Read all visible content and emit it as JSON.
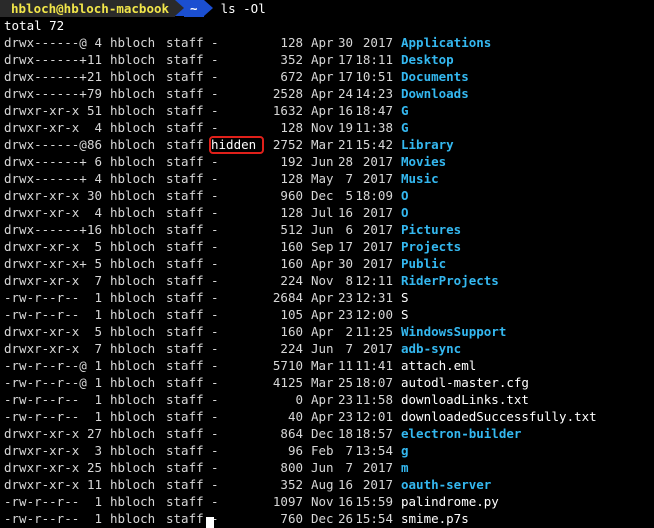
{
  "prompt": {
    "user_host": "hbloch@hbloch-macbook",
    "directory_icon": "home-tilde-icon",
    "directory": "~",
    "command": "ls -Ol"
  },
  "total_line": "total 72",
  "annotation": {
    "label": "hidden",
    "color": "#e0201a"
  },
  "colors": {
    "directory": "#34b8f0",
    "file": "#ffffff",
    "prompt_user": "#f2e64a",
    "prompt_dir_bg": "#1b4fd1"
  },
  "entries": [
    {
      "perm": "drwx------@",
      "links": "4",
      "user": "hbloch",
      "group": "staff",
      "flags": "-",
      "size": "128",
      "month": "Apr",
      "day": "30",
      "time": "2017",
      "name": "Applications",
      "type": "dir"
    },
    {
      "perm": "drwx------+",
      "links": "11",
      "user": "hbloch",
      "group": "staff",
      "flags": "-",
      "size": "352",
      "month": "Apr",
      "day": "17",
      "time": "18:11",
      "name": "Desktop",
      "type": "dir"
    },
    {
      "perm": "drwx------+",
      "links": "21",
      "user": "hbloch",
      "group": "staff",
      "flags": "-",
      "size": "672",
      "month": "Apr",
      "day": "17",
      "time": "10:51",
      "name": "Documents",
      "type": "dir"
    },
    {
      "perm": "drwx------+",
      "links": "79",
      "user": "hbloch",
      "group": "staff",
      "flags": "-",
      "size": "2528",
      "month": "Apr",
      "day": "24",
      "time": "14:23",
      "name": "Downloads",
      "type": "dir"
    },
    {
      "perm": "drwxr-xr-x",
      "links": "51",
      "user": "hbloch",
      "group": "staff",
      "flags": "-",
      "size": "1632",
      "month": "Apr",
      "day": "16",
      "time": "18:47",
      "name": "G",
      "type": "dir"
    },
    {
      "perm": "drwxr-xr-x",
      "links": "4",
      "user": "hbloch",
      "group": "staff",
      "flags": "-",
      "size": "128",
      "month": "Nov",
      "day": "19",
      "time": "11:38",
      "name": "G",
      "type": "dir"
    },
    {
      "perm": "drwx------@",
      "links": "86",
      "user": "hbloch",
      "group": "staff",
      "flags": "hidden",
      "size": "2752",
      "month": "Mar",
      "day": "21",
      "time": "15:42",
      "name": "Library",
      "type": "dir"
    },
    {
      "perm": "drwx------+",
      "links": "6",
      "user": "hbloch",
      "group": "staff",
      "flags": "-",
      "size": "192",
      "month": "Jun",
      "day": "28",
      "time": "2017",
      "name": "Movies",
      "type": "dir"
    },
    {
      "perm": "drwx------+",
      "links": "4",
      "user": "hbloch",
      "group": "staff",
      "flags": "-",
      "size": "128",
      "month": "May",
      "day": "7",
      "time": "2017",
      "name": "Music",
      "type": "dir"
    },
    {
      "perm": "drwxr-xr-x",
      "links": "30",
      "user": "hbloch",
      "group": "staff",
      "flags": "-",
      "size": "960",
      "month": "Dec",
      "day": "5",
      "time": "18:09",
      "name": "O",
      "type": "dir"
    },
    {
      "perm": "drwxr-xr-x",
      "links": "4",
      "user": "hbloch",
      "group": "staff",
      "flags": "-",
      "size": "128",
      "month": "Jul",
      "day": "16",
      "time": "2017",
      "name": "O",
      "type": "dir"
    },
    {
      "perm": "drwx------+",
      "links": "16",
      "user": "hbloch",
      "group": "staff",
      "flags": "-",
      "size": "512",
      "month": "Jun",
      "day": "6",
      "time": "2017",
      "name": "Pictures",
      "type": "dir"
    },
    {
      "perm": "drwxr-xr-x",
      "links": "5",
      "user": "hbloch",
      "group": "staff",
      "flags": "-",
      "size": "160",
      "month": "Sep",
      "day": "17",
      "time": "2017",
      "name": "Projects",
      "type": "dir"
    },
    {
      "perm": "drwxr-xr-x+",
      "links": "5",
      "user": "hbloch",
      "group": "staff",
      "flags": "-",
      "size": "160",
      "month": "Apr",
      "day": "30",
      "time": "2017",
      "name": "Public",
      "type": "dir"
    },
    {
      "perm": "drwxr-xr-x",
      "links": "7",
      "user": "hbloch",
      "group": "staff",
      "flags": "-",
      "size": "224",
      "month": "Nov",
      "day": "8",
      "time": "12:11",
      "name": "RiderProjects",
      "type": "dir"
    },
    {
      "perm": "-rw-r--r--",
      "links": "1",
      "user": "hbloch",
      "group": "staff",
      "flags": "-",
      "size": "2684",
      "month": "Apr",
      "day": "23",
      "time": "12:31",
      "name": "S",
      "type": "file"
    },
    {
      "perm": "-rw-r--r--",
      "links": "1",
      "user": "hbloch",
      "group": "staff",
      "flags": "-",
      "size": "105",
      "month": "Apr",
      "day": "23",
      "time": "12:00",
      "name": "S",
      "type": "file"
    },
    {
      "perm": "drwxr-xr-x",
      "links": "5",
      "user": "hbloch",
      "group": "staff",
      "flags": "-",
      "size": "160",
      "month": "Apr",
      "day": "2",
      "time": "11:25",
      "name": "WindowsSupport",
      "type": "dir"
    },
    {
      "perm": "drwxr-xr-x",
      "links": "7",
      "user": "hbloch",
      "group": "staff",
      "flags": "-",
      "size": "224",
      "month": "Jun",
      "day": "7",
      "time": "2017",
      "name": "adb-sync",
      "type": "dir"
    },
    {
      "perm": "-rw-r--r--@",
      "links": "1",
      "user": "hbloch",
      "group": "staff",
      "flags": "-",
      "size": "5710",
      "month": "Mar",
      "day": "11",
      "time": "11:41",
      "name": "attach.eml",
      "type": "file"
    },
    {
      "perm": "-rw-r--r--@",
      "links": "1",
      "user": "hbloch",
      "group": "staff",
      "flags": "-",
      "size": "4125",
      "month": "Mar",
      "day": "25",
      "time": "18:07",
      "name": "autodl-master.cfg",
      "type": "file"
    },
    {
      "perm": "-rw-r--r--",
      "links": "1",
      "user": "hbloch",
      "group": "staff",
      "flags": "-",
      "size": "0",
      "month": "Apr",
      "day": "23",
      "time": "11:58",
      "name": "downloadLinks.txt",
      "type": "file"
    },
    {
      "perm": "-rw-r--r--",
      "links": "1",
      "user": "hbloch",
      "group": "staff",
      "flags": "-",
      "size": "40",
      "month": "Apr",
      "day": "23",
      "time": "12:01",
      "name": "downloadedSuccessfully.txt",
      "type": "file"
    },
    {
      "perm": "drwxr-xr-x",
      "links": "27",
      "user": "hbloch",
      "group": "staff",
      "flags": "-",
      "size": "864",
      "month": "Dec",
      "day": "18",
      "time": "18:57",
      "name": "electron-builder",
      "type": "dir"
    },
    {
      "perm": "drwxr-xr-x",
      "links": "3",
      "user": "hbloch",
      "group": "staff",
      "flags": "-",
      "size": "96",
      "month": "Feb",
      "day": "7",
      "time": "13:54",
      "name": "g",
      "type": "dir"
    },
    {
      "perm": "drwxr-xr-x",
      "links": "25",
      "user": "hbloch",
      "group": "staff",
      "flags": "-",
      "size": "800",
      "month": "Jun",
      "day": "7",
      "time": "2017",
      "name": "m",
      "type": "dir"
    },
    {
      "perm": "drwxr-xr-x",
      "links": "11",
      "user": "hbloch",
      "group": "staff",
      "flags": "-",
      "size": "352",
      "month": "Aug",
      "day": "16",
      "time": "2017",
      "name": "oauth-server",
      "type": "dir"
    },
    {
      "perm": "-rw-r--r--",
      "links": "1",
      "user": "hbloch",
      "group": "staff",
      "flags": "-",
      "size": "1097",
      "month": "Nov",
      "day": "16",
      "time": "15:59",
      "name": "palindrome.py",
      "type": "file"
    },
    {
      "perm": "-rw-r--r--",
      "links": "1",
      "user": "hbloch",
      "group": "staff",
      "flags": "-",
      "size": "760",
      "month": "Dec",
      "day": "26",
      "time": "15:54",
      "name": "smime.p7s",
      "type": "file"
    }
  ]
}
